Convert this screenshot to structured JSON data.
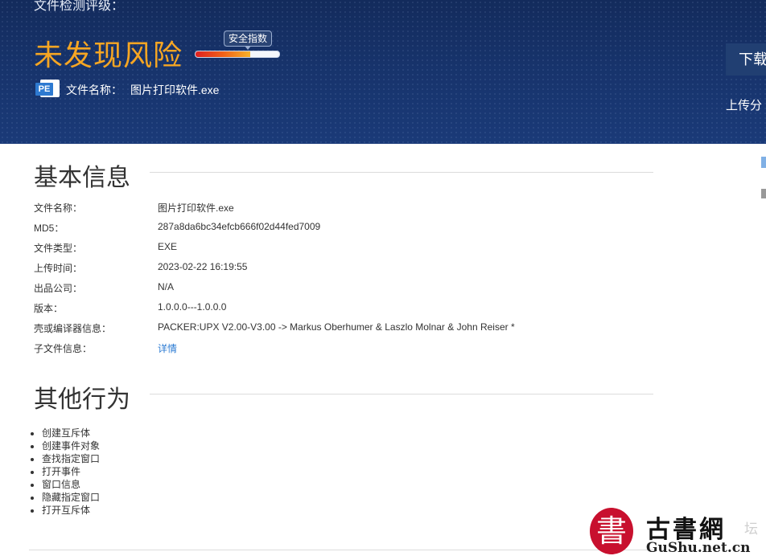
{
  "banner": {
    "heading": "文件检测评级：",
    "verdict": "未发现风险",
    "score_label": "安全指数",
    "score_fill_fraction": 0.65,
    "file_icon_text": "PE",
    "file_name_label": "文件名称：",
    "file_name": "图片打印软件.exe",
    "download_label": "下载",
    "upload_share_label": "上传分"
  },
  "basic_info": {
    "title": "基本信息",
    "rows": [
      {
        "label": "文件名称：",
        "value": "图片打印软件.exe"
      },
      {
        "label": "MD5：",
        "value": "287a8da6bc34efcb666f02d44fed7009"
      },
      {
        "label": "文件类型：",
        "value": "EXE"
      },
      {
        "label": "上传时间：",
        "value": "2023-02-22 16:19:55"
      },
      {
        "label": "出品公司：",
        "value": "N/A"
      },
      {
        "label": "版本：",
        "value": "1.0.0.0---1.0.0.0"
      },
      {
        "label": "壳或编译器信息：",
        "value": "PACKER:UPX V2.00-V3.00 -> Markus Oberhumer & Laszlo Molnar & John Reiser *"
      },
      {
        "label": "子文件信息：",
        "value": "详情"
      }
    ]
  },
  "other_behavior": {
    "title": "其他行为",
    "items": [
      "创建互斥体",
      "创建事件对象",
      "查找指定窗口",
      "打开事件",
      "窗口信息",
      "隐藏指定窗口",
      "打开互斥体"
    ]
  },
  "watermark": {
    "seal_char": "書",
    "title": "古書網",
    "subtitle": "GuShu.net.cn",
    "tail": "坛"
  },
  "colors": {
    "banner_bg": "#17336b",
    "verdict": "#f6a623",
    "link": "#2b7bd3",
    "seal": "#c8102e"
  }
}
